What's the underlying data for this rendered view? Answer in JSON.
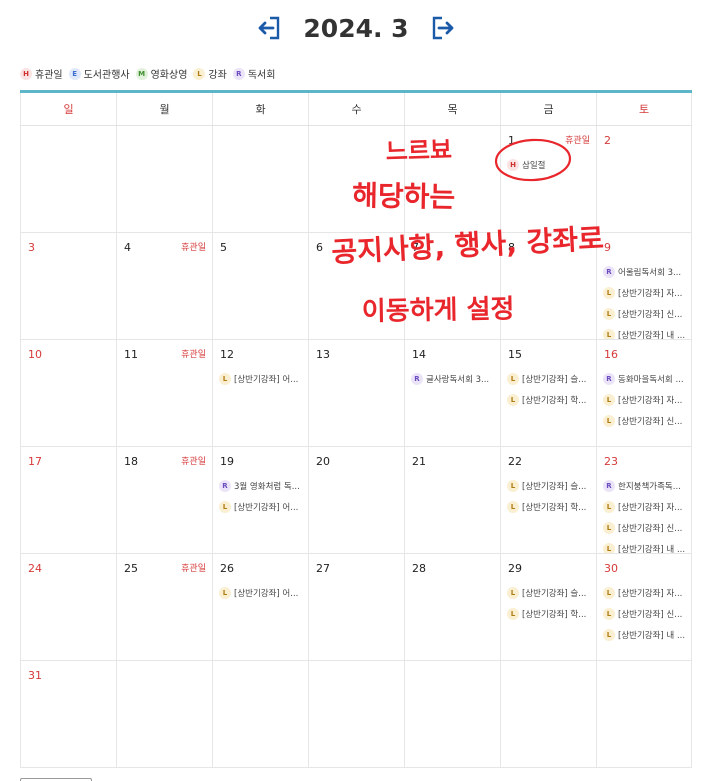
{
  "header": {
    "title": "2024. 3",
    "prev_icon": "prev-month-icon",
    "next_icon": "next-month-icon",
    "accent": "#1a5aa8"
  },
  "legend": [
    {
      "code": "H",
      "label": "휴관일"
    },
    {
      "code": "E",
      "label": "도서관행사"
    },
    {
      "code": "M",
      "label": "영화상영"
    },
    {
      "code": "L",
      "label": "강좌"
    },
    {
      "code": "R",
      "label": "독서회"
    }
  ],
  "weekdays": [
    "일",
    "월",
    "화",
    "수",
    "목",
    "금",
    "토"
  ],
  "holiday_label": "휴관일",
  "weeks": [
    [
      {
        "day": ""
      },
      {
        "day": ""
      },
      {
        "day": ""
      },
      {
        "day": ""
      },
      {
        "day": ""
      },
      {
        "day": "1",
        "holiday": true,
        "events": [
          {
            "code": "H",
            "text": "삼일절"
          }
        ]
      },
      {
        "day": "2"
      }
    ],
    [
      {
        "day": "3"
      },
      {
        "day": "4",
        "holiday": true
      },
      {
        "day": "5"
      },
      {
        "day": "6"
      },
      {
        "day": "7"
      },
      {
        "day": "8"
      },
      {
        "day": "9",
        "events": [
          {
            "code": "R",
            "text": "어울림독서회 3..."
          },
          {
            "code": "L",
            "text": "[상반기강좌] 자..."
          },
          {
            "code": "L",
            "text": "[상반기강좌] 신..."
          },
          {
            "code": "L",
            "text": "[상반기강좌] 내 ..."
          }
        ]
      }
    ],
    [
      {
        "day": "10"
      },
      {
        "day": "11",
        "holiday": true
      },
      {
        "day": "12",
        "events": [
          {
            "code": "L",
            "text": "[상반기강좌] 어..."
          }
        ]
      },
      {
        "day": "13"
      },
      {
        "day": "14",
        "events": [
          {
            "code": "R",
            "text": "글사랑독서회 3..."
          }
        ]
      },
      {
        "day": "15",
        "events": [
          {
            "code": "L",
            "text": "[상반기강좌] 슬..."
          },
          {
            "code": "L",
            "text": "[상반기강좌] 학..."
          }
        ]
      },
      {
        "day": "16",
        "events": [
          {
            "code": "R",
            "text": "동화마을독서회 ..."
          },
          {
            "code": "L",
            "text": "[상반기강좌] 자..."
          },
          {
            "code": "L",
            "text": "[상반기강좌] 신..."
          }
        ]
      }
    ],
    [
      {
        "day": "17"
      },
      {
        "day": "18",
        "holiday": true
      },
      {
        "day": "19",
        "events": [
          {
            "code": "R",
            "text": "3월 영화처럼 독..."
          },
          {
            "code": "L",
            "text": "[상반기강좌] 어..."
          }
        ]
      },
      {
        "day": "20"
      },
      {
        "day": "21"
      },
      {
        "day": "22",
        "events": [
          {
            "code": "L",
            "text": "[상반기강좌] 슬..."
          },
          {
            "code": "L",
            "text": "[상반기강좌] 학..."
          }
        ]
      },
      {
        "day": "23",
        "events": [
          {
            "code": "R",
            "text": "한지붕책가족독..."
          },
          {
            "code": "L",
            "text": "[상반기강좌] 자..."
          },
          {
            "code": "L",
            "text": "[상반기강좌] 신..."
          },
          {
            "code": "L",
            "text": "[상반기강좌] 내 ..."
          }
        ]
      }
    ],
    [
      {
        "day": "24"
      },
      {
        "day": "25",
        "holiday": true
      },
      {
        "day": "26",
        "events": [
          {
            "code": "L",
            "text": "[상반기강좌] 어..."
          }
        ]
      },
      {
        "day": "27"
      },
      {
        "day": "28"
      },
      {
        "day": "29",
        "events": [
          {
            "code": "L",
            "text": "[상반기강좌] 슬..."
          },
          {
            "code": "L",
            "text": "[상반기강좌] 학..."
          }
        ]
      },
      {
        "day": "30",
        "events": [
          {
            "code": "L",
            "text": "[상반기강좌] 자..."
          },
          {
            "code": "L",
            "text": "[상반기강좌] 신..."
          },
          {
            "code": "L",
            "text": "[상반기강좌] 내 ..."
          }
        ]
      }
    ],
    [
      {
        "day": "31"
      },
      {
        "day": ""
      },
      {
        "day": ""
      },
      {
        "day": ""
      },
      {
        "day": ""
      },
      {
        "day": ""
      },
      {
        "day": ""
      }
    ]
  ],
  "annotation": {
    "color": "#e8262c",
    "lines": [
      "느르뵤",
      "해당하는",
      "공지사항, 행사, 강좌로",
      "이동하게 설정"
    ]
  }
}
